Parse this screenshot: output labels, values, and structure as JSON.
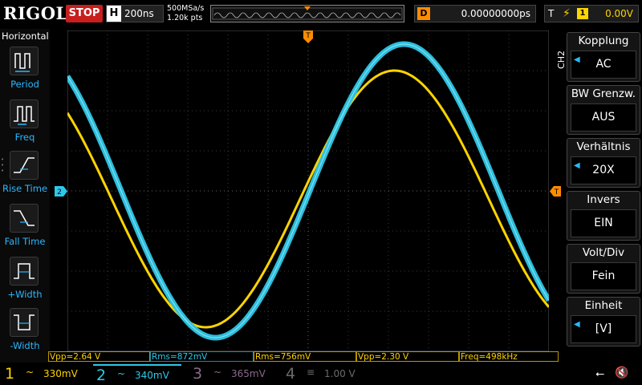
{
  "top": {
    "brand": "RIGOL",
    "run_state": "STOP",
    "horizontal_label": "H",
    "timebase": "200ns",
    "sample_rate": "500MSa/s",
    "points": "1.20k pts",
    "delay_label": "D",
    "delay_value": "0.00000000ps",
    "trigger_label": "T",
    "trigger_source": "1",
    "trigger_level": "0.00V"
  },
  "left_menu": {
    "title": "Horizontal",
    "items": [
      {
        "label": "Period",
        "icon": "period-icon"
      },
      {
        "label": "Freq",
        "icon": "freq-icon"
      },
      {
        "label": "Rise Time",
        "icon": "rise-time-icon"
      },
      {
        "label": "Fall Time",
        "icon": "fall-time-icon"
      },
      {
        "label": "+Width",
        "icon": "pos-width-icon"
      },
      {
        "label": "-Width",
        "icon": "neg-width-icon"
      }
    ]
  },
  "right_menu": {
    "channel_tag": "CH2",
    "items": [
      {
        "title": "Kopplung",
        "value": "AC",
        "has_arrow": true
      },
      {
        "title": "BW Grenzw.",
        "value": "AUS",
        "has_arrow": false
      },
      {
        "title": "Verhältnis",
        "value": "20X",
        "has_arrow": true
      },
      {
        "title": "Invers",
        "value": "EIN",
        "has_arrow": false
      },
      {
        "title": "Volt/Div",
        "value": "Fein",
        "has_arrow": false
      },
      {
        "title": "Einheit",
        "value": "[V]",
        "has_arrow": true
      }
    ]
  },
  "markers": {
    "ch2_ref": "2",
    "trigger_pos": "T"
  },
  "measurements": [
    {
      "text": "Vpp=2.64 V",
      "channel": "ch1"
    },
    {
      "text": "Rms=872mV",
      "channel": "ch2"
    },
    {
      "text": "Rms=756mV",
      "channel": "ch1"
    },
    {
      "text": "Vpp=2.30 V",
      "channel": "ch1"
    },
    {
      "text": "Freq=498kHz",
      "channel": "ch1"
    }
  ],
  "channels": [
    {
      "num": "1",
      "coupling": "~",
      "scale": "330mV"
    },
    {
      "num": "2",
      "coupling": "~",
      "scale": "340mV"
    },
    {
      "num": "3",
      "coupling": "~",
      "scale": "365mV"
    },
    {
      "num": "4",
      "coupling": "≡",
      "scale": "1.00 V"
    }
  ],
  "colors": {
    "ch1": "#ffd400",
    "ch2": "#2ec8e8",
    "trigger": "#ff8c00",
    "stop": "#c81e1e",
    "menu_accent": "#2ab8ff"
  },
  "status_icons": [
    "usb-icon",
    "speaker-muted-icon"
  ]
}
